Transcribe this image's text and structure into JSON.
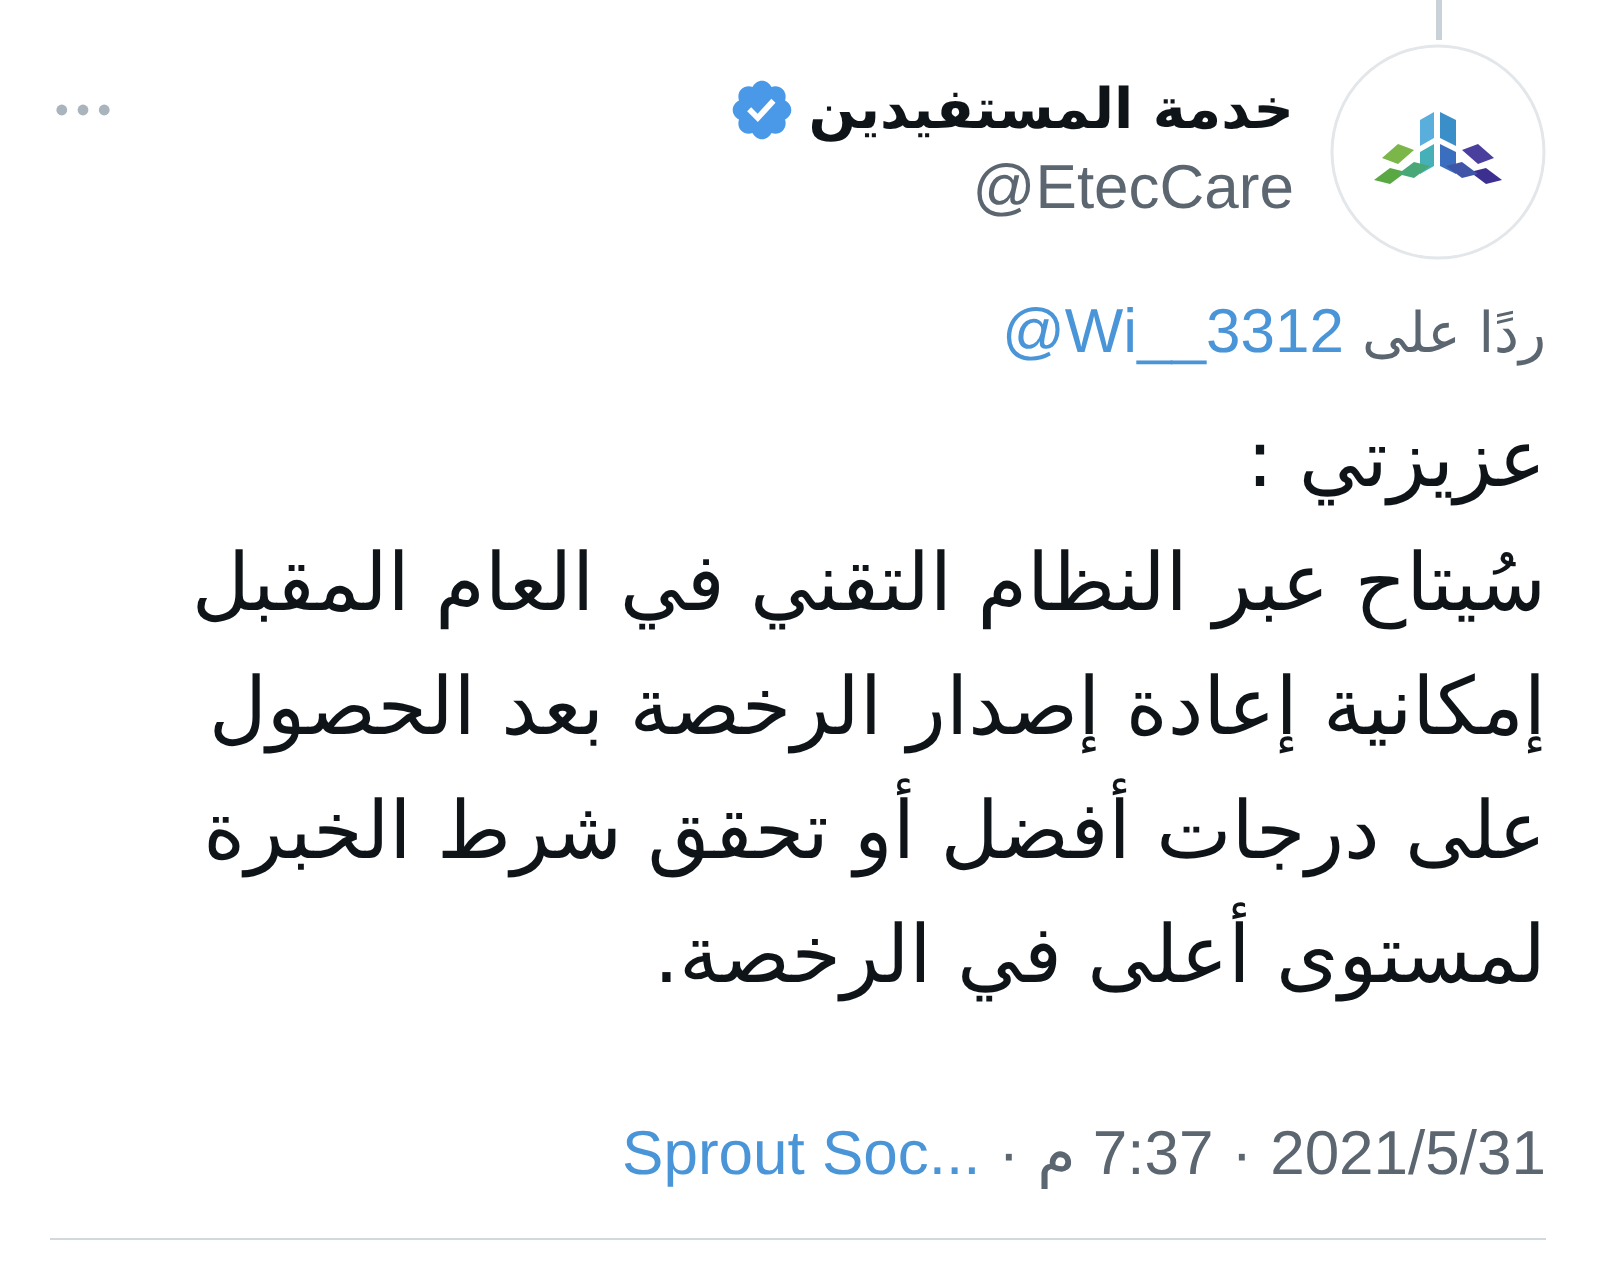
{
  "author": {
    "name": "خدمة المستفيدين",
    "verified": true,
    "handle": "@EtecCare"
  },
  "reply_to": {
    "label": "ردًا على",
    "handle": "@Wi__3312"
  },
  "body": "عزيزتي :\nسُيتاح عبر النظام التقني في العام المقبل\nإمكانية إعادة إصدار الرخصة بعد الحصول\nعلى درجات أفضل أو تحقق شرط الخبرة\nلمستوى أعلى في الرخصة.",
  "meta": [
    {
      "kind": "date",
      "text": "2021/5/31"
    },
    {
      "kind": "separator",
      "text": "·"
    },
    {
      "kind": "time",
      "text": "7:37 م"
    },
    {
      "kind": "separator",
      "text": "·"
    },
    {
      "kind": "link",
      "text": "Sprout Soc..."
    }
  ]
}
